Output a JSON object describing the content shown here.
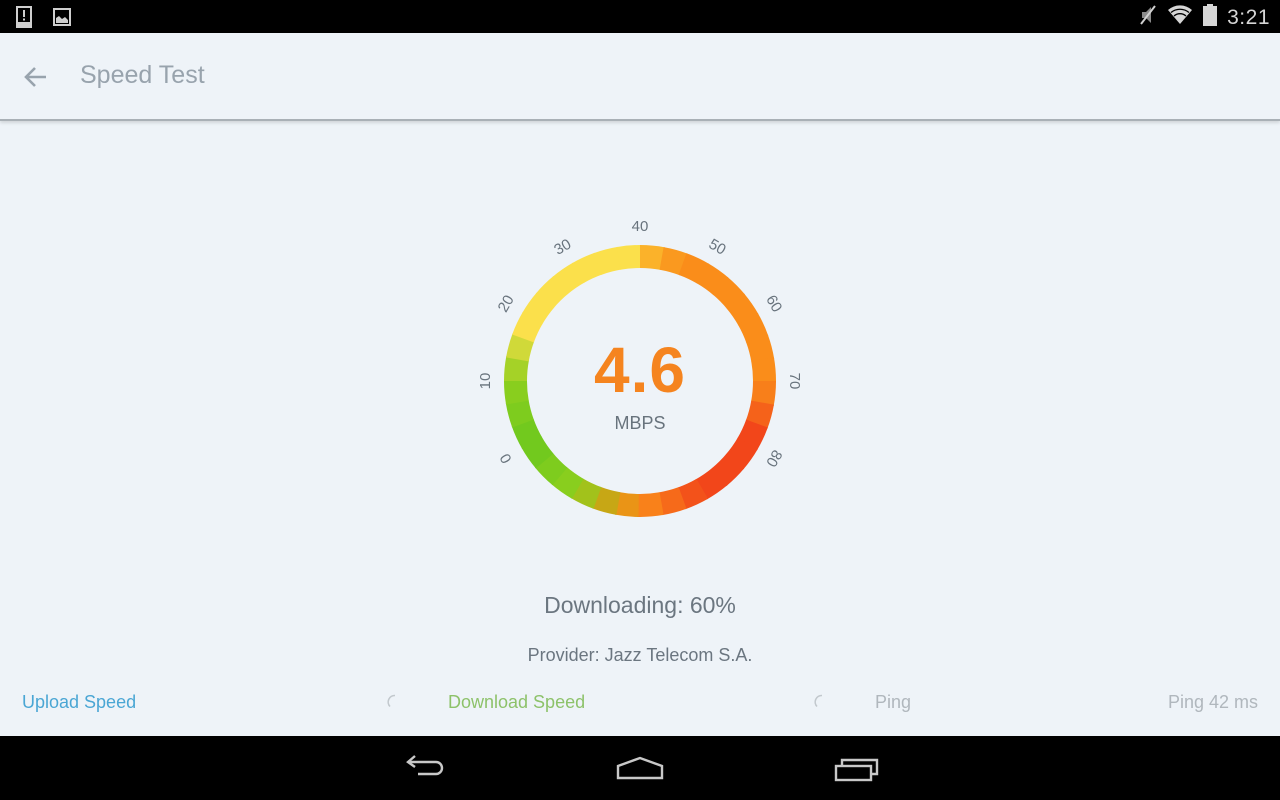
{
  "status_bar": {
    "left_icons": [
      "alert-notification-icon",
      "image-notification-icon"
    ],
    "right_icons": [
      "mute-icon",
      "wifi-icon",
      "battery-icon"
    ],
    "time": "3:21"
  },
  "app_bar": {
    "back_icon": "arrow-left-icon",
    "title": "Speed Test"
  },
  "gauge": {
    "current_speed": "4.6",
    "unit": "MBPS",
    "scale_min": 0,
    "scale_max": 80,
    "tick_labels": [
      "0",
      "10",
      "20",
      "30",
      "40",
      "50",
      "60",
      "70",
      "80"
    ],
    "colors": {
      "value": "#f5841f",
      "green": "#8fcf1e",
      "yellow": "#fbe04b",
      "orange": "#fa8d1a",
      "red": "#f2461a"
    }
  },
  "status": {
    "progress_text": "Downloading: 60%",
    "progress_percent": 60,
    "provider": "Provider: Jazz Telecom S.A."
  },
  "metrics": {
    "upload_label": "Upload Speed",
    "download_label": "Download Speed",
    "ping_label": "Ping",
    "ping_value": "Ping 42 ms",
    "upload_color": "#4aa6d4",
    "download_color": "#8dc26a"
  },
  "nav_bar": {
    "buttons": [
      "back-nav-icon",
      "home-nav-icon",
      "recents-nav-icon"
    ]
  }
}
